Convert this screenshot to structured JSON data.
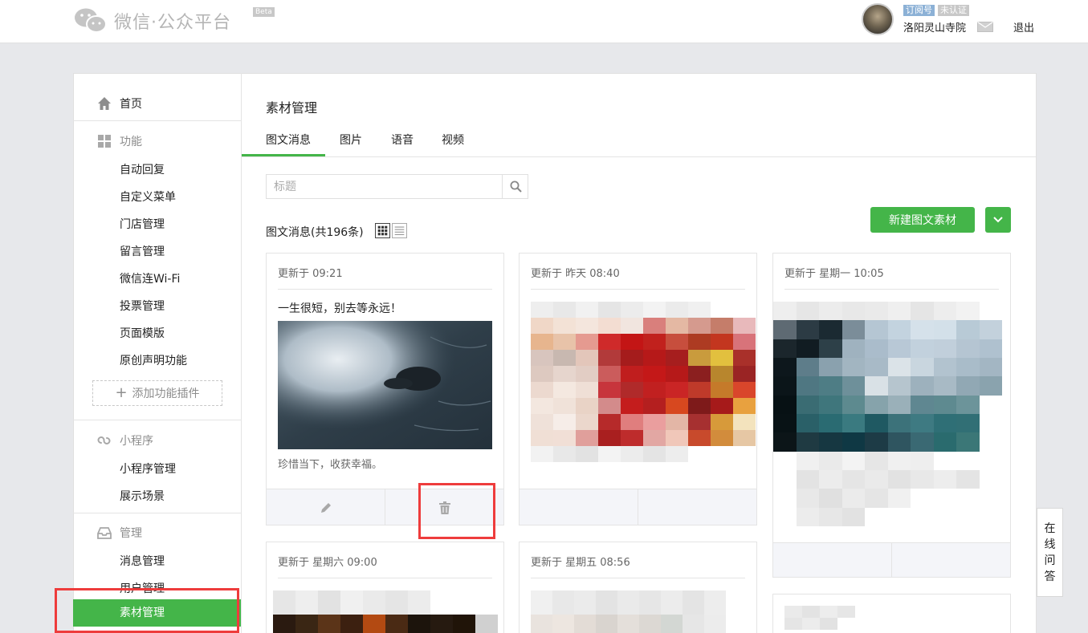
{
  "header": {
    "logo_text": "微信·公众平台",
    "beta": "Beta",
    "tag_subscription": "订阅号",
    "tag_unverified": "未认证",
    "account_name": "洛阳灵山寺院",
    "logout": "退出"
  },
  "sidebar": {
    "home": "首页",
    "function": "功能",
    "function_items": [
      "自动回复",
      "自定义菜单",
      "门店管理",
      "留言管理",
      "微信连Wi-Fi",
      "投票管理",
      "页面模版",
      "原创声明功能"
    ],
    "add_plugin": "添加功能插件",
    "miniprogram": "小程序",
    "miniprogram_items": [
      "小程序管理",
      "展示场景"
    ],
    "manage": "管理",
    "manage_items": [
      "消息管理",
      "用户管理"
    ],
    "active_item": "素材管理"
  },
  "content": {
    "page_title": "素材管理",
    "tabs": [
      "图文消息",
      "图片",
      "语音",
      "视频"
    ],
    "search_placeholder": "标题",
    "count_text": "图文消息(共196条)",
    "new_button": "新建图文素材"
  },
  "cards": [
    {
      "updated": "更新于 09:21",
      "title": "一生很短，别去等永远！",
      "desc": "珍惜当下，收获幸福。"
    },
    {
      "updated": "更新于 昨天 08:40"
    },
    {
      "updated": "更新于 星期一 10:05"
    },
    {
      "updated": "更新于 星期六 09:00"
    },
    {
      "updated": "更新于 星期五 08:56"
    }
  ],
  "float_qa": [
    "在",
    "线",
    "问",
    "答"
  ],
  "colors": {
    "accent": "#44b549",
    "highlight": "#ee3c3c"
  }
}
